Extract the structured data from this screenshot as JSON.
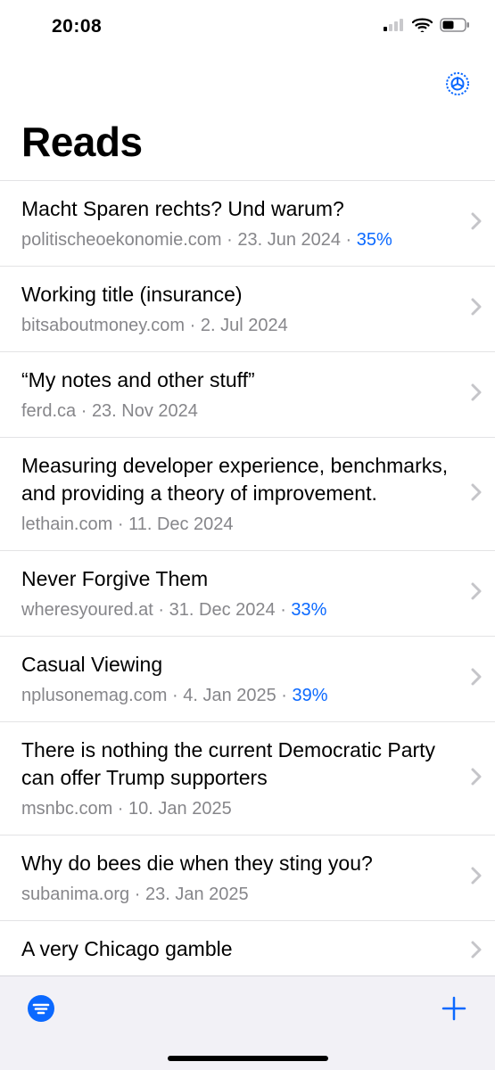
{
  "status": {
    "time": "20:08"
  },
  "colors": {
    "accent": "#0b69ff",
    "muted": "#86868a"
  },
  "header": {
    "title": "Reads"
  },
  "articles": [
    {
      "title": "Macht Sparen rechts? Und warum?",
      "domain": "politischeoekonomie.com",
      "date": "23. Jun 2024",
      "progress": "35%"
    },
    {
      "title": "Working title (insurance)",
      "domain": "bitsaboutmoney.com",
      "date": "2. Jul 2024",
      "progress": null
    },
    {
      "title": "“My notes and other stuff”",
      "domain": "ferd.ca",
      "date": "23. Nov 2024",
      "progress": null
    },
    {
      "title": "Measuring developer experience, benchmarks, and providing a theory of improvement.",
      "domain": "lethain.com",
      "date": "11. Dec 2024",
      "progress": null
    },
    {
      "title": "Never Forgive Them",
      "domain": "wheresyoured.at",
      "date": "31. Dec 2024",
      "progress": "33%"
    },
    {
      "title": "Casual Viewing",
      "domain": "nplusonemag.com",
      "date": "4. Jan 2025",
      "progress": "39%"
    },
    {
      "title": "There is nothing the current Democratic Party can offer Trump supporters",
      "domain": "msnbc.com",
      "date": "10. Jan 2025",
      "progress": null
    },
    {
      "title": "Why do bees die when they sting you?",
      "domain": "subanima.org",
      "date": "23. Jan 2025",
      "progress": null
    },
    {
      "title": "A very Chicago gamble",
      "domain": "",
      "date": "",
      "progress": null
    }
  ],
  "icons": {
    "settings": "gear-icon",
    "filter": "filter-icon",
    "add": "plus-icon",
    "disclosure": "chevron-right-icon",
    "signal": "cell-signal-icon",
    "wifi": "wifi-icon",
    "battery": "battery-icon"
  }
}
